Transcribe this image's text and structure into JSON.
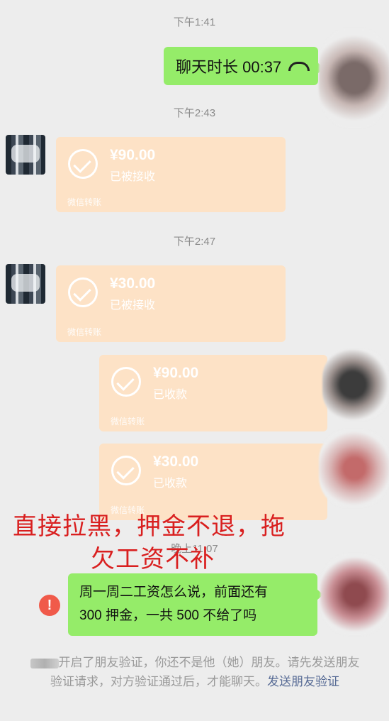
{
  "times": {
    "t1": "下午1:41",
    "t2": "下午2:43",
    "t3": "下午2:47",
    "t4": "晚上11:07"
  },
  "call": {
    "label": "聊天时长 00:37",
    "icon": "phone-hangup-icon"
  },
  "transfers": [
    {
      "amount": "¥90.00",
      "status": "已被接收",
      "footer": "微信转账"
    },
    {
      "amount": "¥30.00",
      "status": "已被接收",
      "footer": "微信转账"
    },
    {
      "amount": "¥90.00",
      "status": "已收款",
      "footer": "微信转账"
    },
    {
      "amount": "¥30.00",
      "status": "已收款",
      "footer": "微信转账"
    }
  ],
  "overlay": {
    "line1": "直接拉黑，押金不退，拖",
    "line2": "欠工资不补"
  },
  "message": {
    "line1": "周一周二工资怎么说，前面还有",
    "line2": "300 押金，一共 500 不给了吗",
    "warning": "!"
  },
  "notice": {
    "part1": "开启了朋友验证，你还不是他（她）朋友。请先发送朋友验证请求，对方验证通过后，才能聊天。",
    "link": "发送朋友验证"
  },
  "colors": {
    "bubble_green": "#95ec69",
    "transfer": "#fde2c6",
    "overlay_red": "#d91f1f",
    "link": "#576b95"
  }
}
